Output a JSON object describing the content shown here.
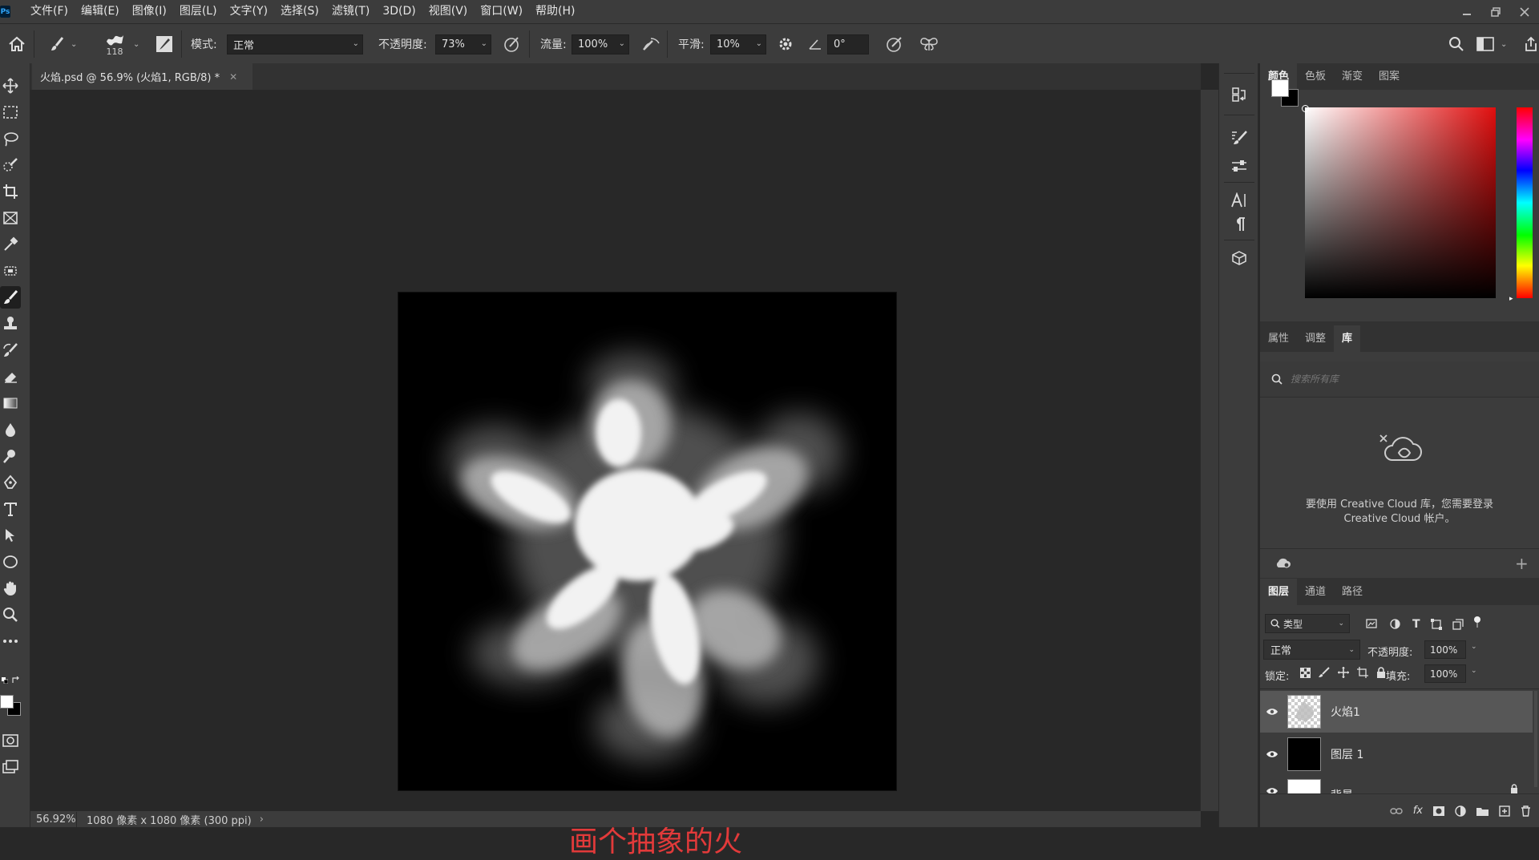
{
  "app": {
    "logo": "Ps"
  },
  "menu": [
    "文件(F)",
    "编辑(E)",
    "图像(I)",
    "图层(L)",
    "文字(Y)",
    "选择(S)",
    "滤镜(T)",
    "3D(D)",
    "视图(V)",
    "窗口(W)",
    "帮助(H)"
  ],
  "options": {
    "brush_size": "118",
    "mode_label": "模式:",
    "mode_value": "正常",
    "opacity_label": "不透明度:",
    "opacity_value": "73%",
    "flow_label": "流量:",
    "flow_value": "100%",
    "smooth_label": "平滑:",
    "smooth_value": "10%",
    "angle_value": "0°"
  },
  "document": {
    "tab_title": "火焰.psd @ 56.9% (火焰1, RGB/8) *",
    "caption": "画个抽象的火",
    "zoom": "56.92%",
    "info": "1080 像素 x 1080 像素 (300 ppi)"
  },
  "color_panel": {
    "tabs": [
      "颜色",
      "色板",
      "渐变",
      "图案"
    ],
    "foreground": "#ffffff",
    "background": "#000000"
  },
  "library_panel": {
    "tabs": [
      "属性",
      "调整",
      "库"
    ],
    "search_placeholder": "搜索所有库",
    "message_line1": "要使用 Creative Cloud 库，您需要登录",
    "message_line2": "Creative Cloud 帐户。"
  },
  "layers_panel": {
    "tabs": [
      "图层",
      "通道",
      "路径"
    ],
    "filter_label": "类型",
    "blend_mode": "正常",
    "opacity_label": "不透明度:",
    "opacity_value": "100%",
    "lock_label": "锁定:",
    "fill_label": "填充:",
    "fill_value": "100%",
    "layers": [
      {
        "name": "火焰1",
        "selected": true
      },
      {
        "name": "图层 1",
        "selected": false
      },
      {
        "name": "背景",
        "selected": false
      }
    ]
  }
}
